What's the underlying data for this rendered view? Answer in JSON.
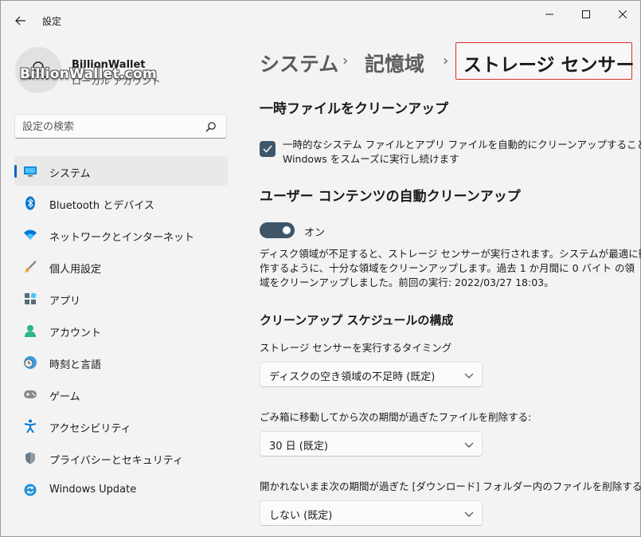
{
  "window": {
    "app_title": "設定",
    "controls": {
      "minimize": "minimize-icon",
      "maximize": "maximize-icon",
      "close": "close-icon"
    }
  },
  "profile": {
    "name": "BillionWallet",
    "account_type": "ローカル アカウント",
    "watermark": "BillionWallet.com"
  },
  "search": {
    "placeholder": "設定の検索",
    "value": ""
  },
  "sidebar": {
    "items": [
      {
        "label": "システム",
        "icon": "system-display-icon",
        "active": true
      },
      {
        "label": "Bluetooth とデバイス",
        "icon": "bluetooth-icon",
        "active": false
      },
      {
        "label": "ネットワークとインターネット",
        "icon": "wifi-icon",
        "active": false
      },
      {
        "label": "個人用設定",
        "icon": "brush-icon",
        "active": false
      },
      {
        "label": "アプリ",
        "icon": "apps-icon",
        "active": false
      },
      {
        "label": "アカウント",
        "icon": "person-icon",
        "active": false
      },
      {
        "label": "時刻と言語",
        "icon": "clock-globe-icon",
        "active": false
      },
      {
        "label": "ゲーム",
        "icon": "gamepad-icon",
        "active": false
      },
      {
        "label": "アクセシビリティ",
        "icon": "accessibility-icon",
        "active": false
      },
      {
        "label": "プライバシーとセキュリティ",
        "icon": "shield-icon",
        "active": false
      },
      {
        "label": "Windows Update",
        "icon": "update-icon",
        "active": false
      }
    ]
  },
  "breadcrumb": {
    "items": [
      "システム",
      "記憶域"
    ],
    "separator": "›",
    "current": "ストレージ センサー"
  },
  "main": {
    "temp_section": {
      "title": "一時ファイルをクリーンアップ",
      "checkbox_checked": true,
      "checkbox_text_line1": "一時的なシステム ファイルとアプリ ファイルを自動的にクリーンアップすることで、",
      "checkbox_text_line2": "Windows をスムーズに実行し続けます"
    },
    "auto_section": {
      "title": "ユーザー コンテンツの自動クリーンアップ",
      "toggle_on": true,
      "toggle_label": "オン",
      "desc_line1": "ディスク領域が不足すると、ストレージ センサーが実行されます。システムが最適に動",
      "desc_line2": "作するように、十分な領域をクリーンアップします。過去 1 か月間に 0 バイト の領",
      "desc_line3": "域をクリーンアップしました。前回の実行: 2022/03/27 18:03。"
    },
    "schedule_section": {
      "title": "クリーンアップ スケジュールの構成",
      "run_label": "ストレージ センサーを実行するタイミング",
      "run_value": "ディスクの空き領域の不足時 (既定)",
      "recycle_label": "ごみ箱に移動してから次の期間が過ぎたファイルを削除する:",
      "recycle_value": "30 日 (既定)",
      "downloads_label": "開かれないまま次の期間が過ぎた [ダウンロード] フォルダー内のファイルを削除する:",
      "downloads_value": "しない (既定)"
    }
  },
  "colors": {
    "accent": "#0067c0",
    "toggle_checkbox_fill": "#3f5668",
    "highlight_border": "#d9302b",
    "background": "#f3f3f3"
  }
}
